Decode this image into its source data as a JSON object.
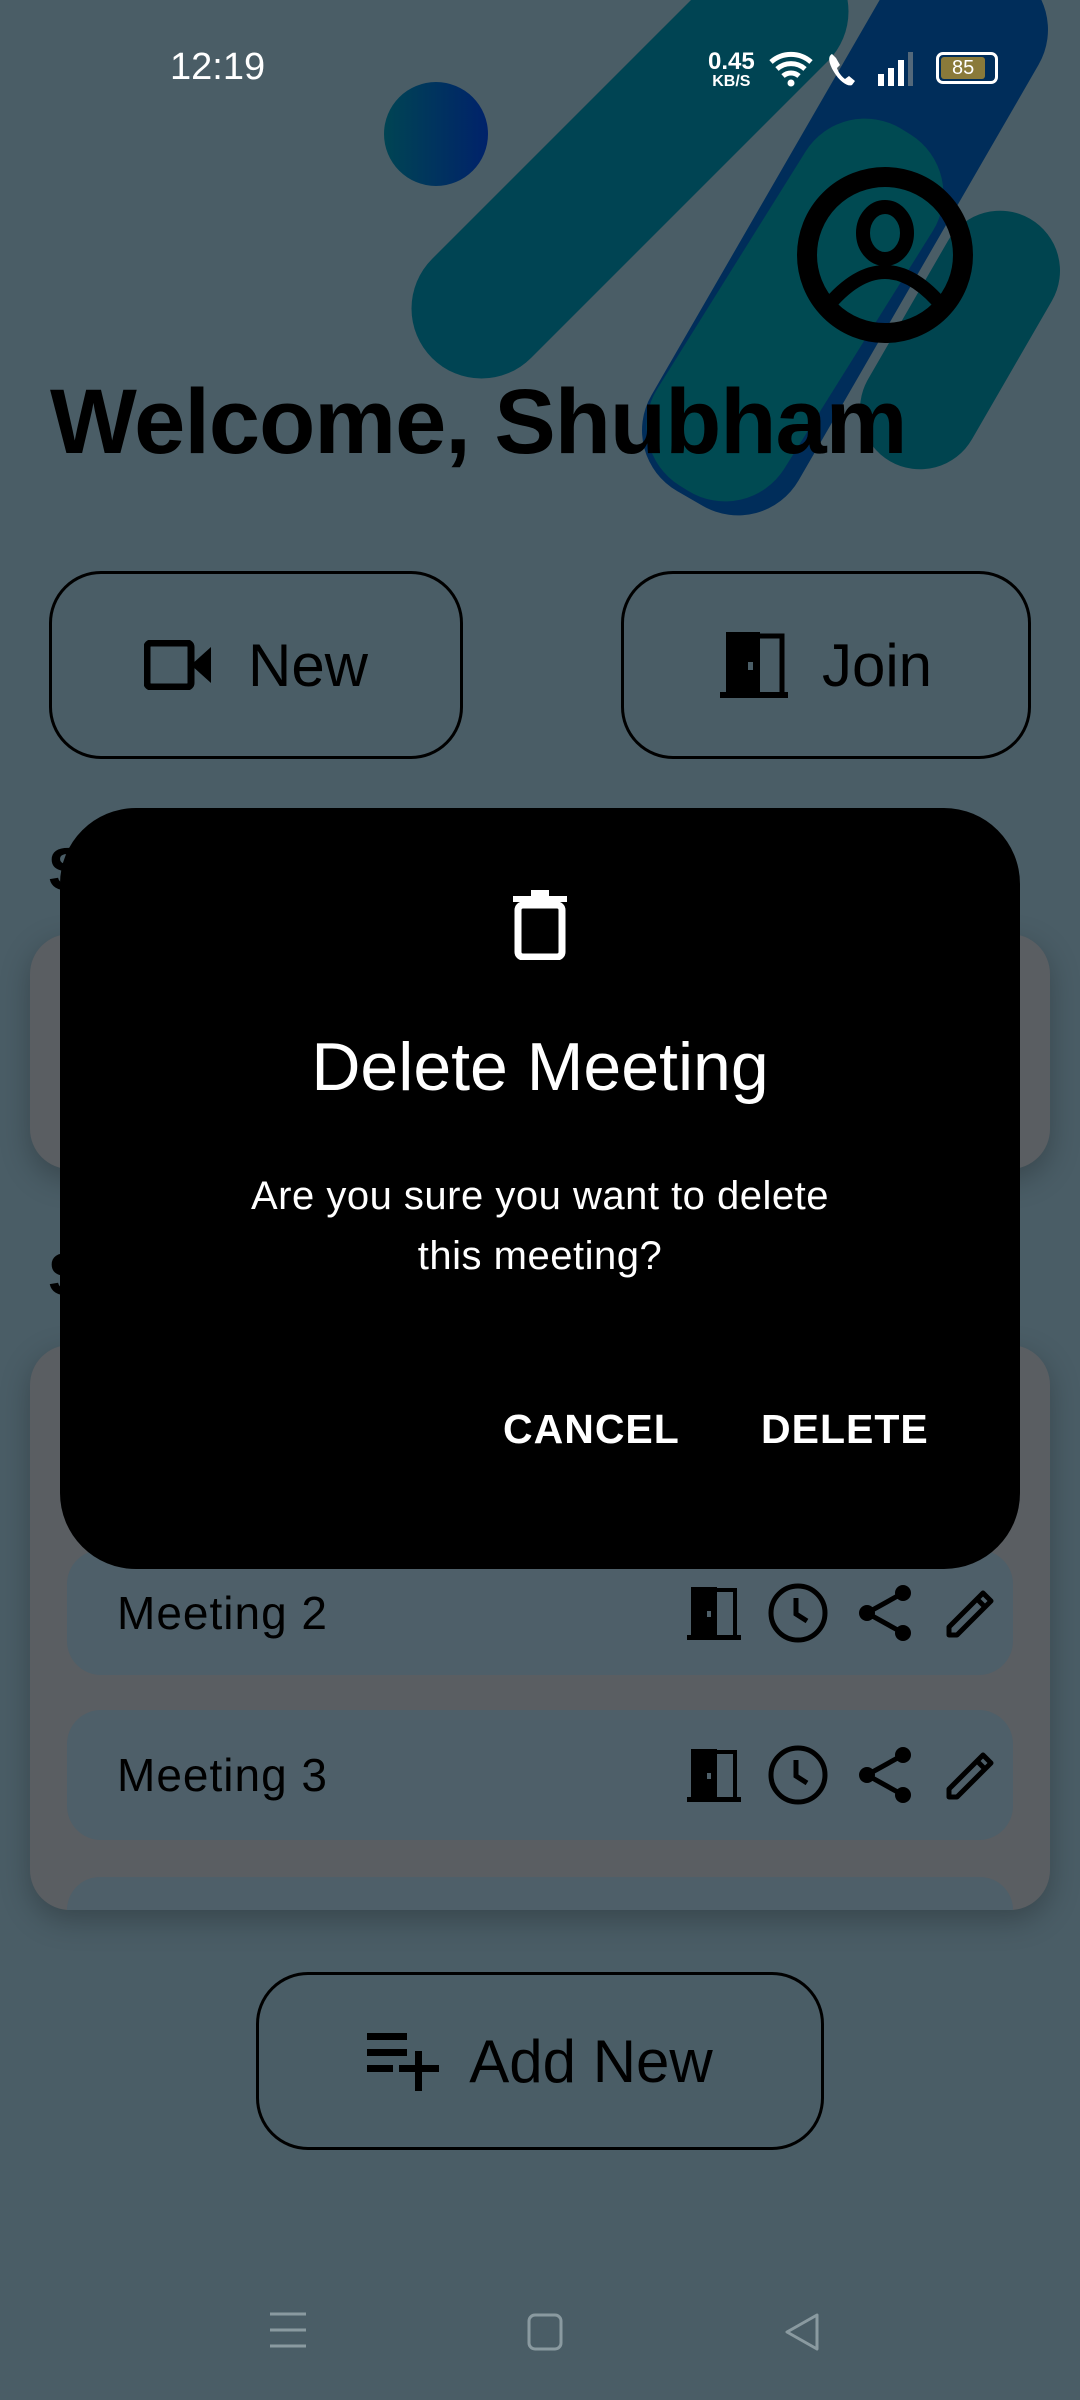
{
  "status_bar": {
    "time": "12:19",
    "net_speed": "0.45",
    "net_unit": "KB/S",
    "battery": "85"
  },
  "header": {
    "welcome": "Welcome, Shubham"
  },
  "actions": {
    "new_label": "New",
    "join_label": "Join"
  },
  "sections": {
    "first_heading_visible": "S",
    "second_heading_visible": "S"
  },
  "meetings": [
    {
      "name": "Meeting 2"
    },
    {
      "name": "Meeting 3"
    }
  ],
  "add_new_label": "Add New",
  "dialog": {
    "title": "Delete Meeting",
    "message": "Are you sure you want to delete this meeting?",
    "cancel": "CANCEL",
    "delete": "DELETE"
  },
  "colors": {
    "background": "#4a5d66",
    "dialog": "#000000",
    "accent_teal": "#004a52",
    "accent_blue": "#002d5a"
  }
}
